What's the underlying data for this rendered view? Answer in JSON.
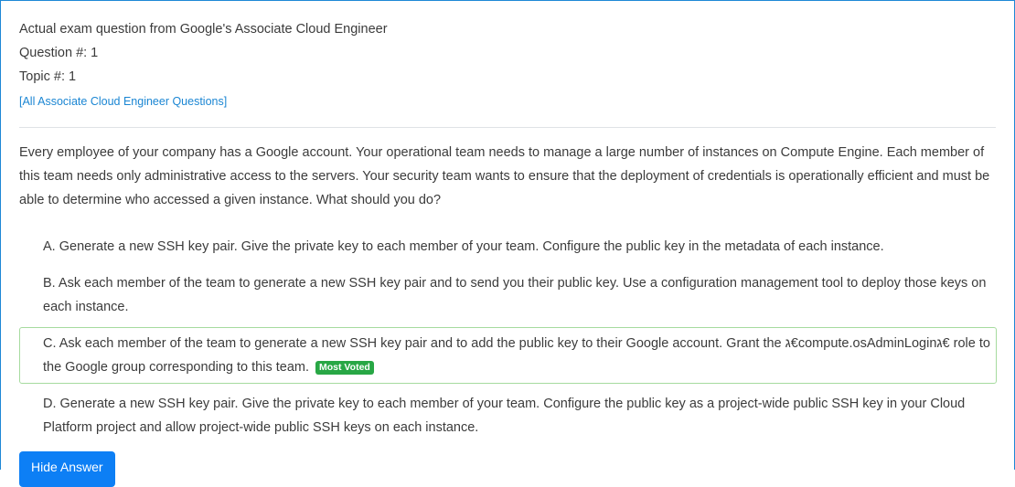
{
  "header": {
    "source_line": "Actual exam question from Google's Associate Cloud Engineer",
    "question_number": "Question #: 1",
    "topic_number": "Topic #: 1",
    "all_questions_link": "[All Associate Cloud Engineer Questions]"
  },
  "question": {
    "text": "Every employee of your company has a Google account. Your operational team needs to manage a large number of instances on Compute Engine. Each member of this team needs only administrative access to the servers. Your security team wants to ensure that the deployment of credentials is operationally efficient and must be able to determine who accessed a given instance. What should you do?"
  },
  "choices": [
    {
      "text": "A. Generate a new SSH key pair. Give the private key to each member of your team. Configure the public key in the metadata of each instance."
    },
    {
      "text": "B. Ask each member of the team to generate a new SSH key pair and to send you their public key. Use a configuration management tool to deploy those keys on each instance."
    },
    {
      "text": "C. Ask each member of the team to generate a new SSH key pair and to add the public key to their Google account. Grant the ג€compute.osAdminLoginג€ role to the Google group corresponding to this team.",
      "badge": "Most Voted"
    },
    {
      "text": "D. Generate a new SSH key pair. Give the private key to each member of your team. Configure the public key as a project-wide public SSH key in your Cloud Platform project and allow project-wide public SSH keys on each instance."
    }
  ],
  "actions": {
    "hide_answer_label": "Hide Answer"
  },
  "colors": {
    "accent_blue": "#1b86d3",
    "button_blue": "#0d7ff5",
    "correct_border": "#a6db9e",
    "badge_green": "#28a745"
  }
}
